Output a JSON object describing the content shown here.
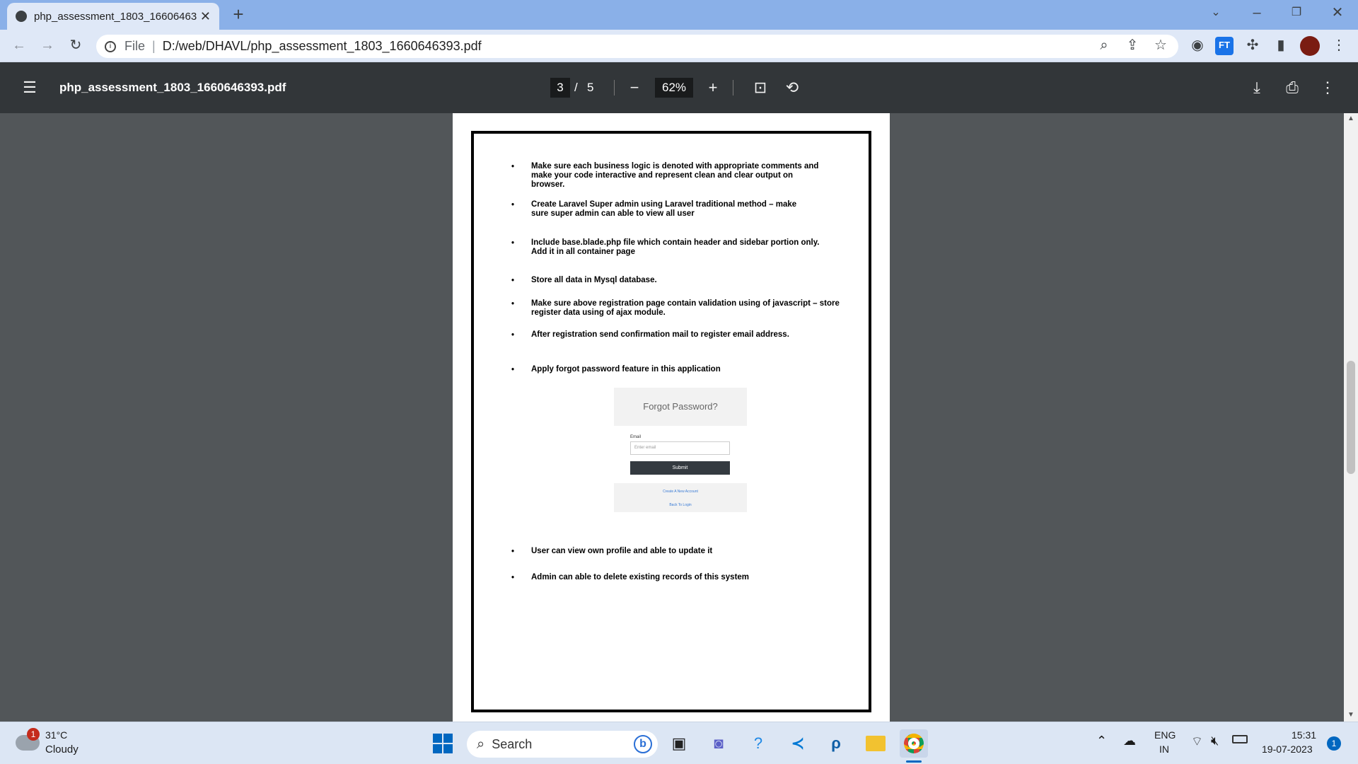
{
  "browser": {
    "tab_title": "php_assessment_1803_16606463",
    "address_prefix": "File",
    "address_url": "D:/web/DHAVL/php_assessment_1803_1660646393.pdf"
  },
  "pdf_viewer": {
    "file_title": "php_assessment_1803_1660646393.pdf",
    "current_page": "3",
    "page_separator": "/",
    "total_pages": "5",
    "zoom": "62%"
  },
  "document": {
    "bullets": [
      {
        "lines": [
          "Make sure each business logic is denoted with appropriate comments and",
          "make your code interactive and represent clean and clear output on",
          "browser."
        ]
      },
      {
        "lines": [
          "Create Laravel Super admin using Laravel traditional method – make",
          "sure super admin can able to view all user"
        ]
      },
      {
        "lines": [
          "Include base.blade.php file which contain header and sidebar portion only.",
          "Add it in all container page"
        ]
      },
      {
        "lines": [
          "Store all data in Mysql database."
        ]
      },
      {
        "lines": [
          "Make sure above registration page contain validation using of javascript – store",
          "register data using of ajax module."
        ]
      },
      {
        "lines": [
          "After registration send confirmation mail to register email address."
        ]
      },
      {
        "lines": [
          "Apply forgot password feature in this application"
        ]
      },
      {
        "lines": [
          "User can view own profile and able to update it"
        ]
      },
      {
        "lines": [
          "Admin can able to delete existing records of this system"
        ]
      }
    ],
    "forgot_password": {
      "title": "Forgot Password?",
      "email_label": "Email",
      "email_placeholder": "Enter email",
      "submit_label": "Submit",
      "create_account_link": "Create A New Account",
      "back_to_login_link": "Back To Login"
    }
  },
  "taskbar": {
    "weather_temp": "31°C",
    "weather_desc": "Cloudy",
    "weather_badge": "1",
    "search_label": "Search",
    "lang_top": "ENG",
    "lang_bottom": "IN",
    "time": "15:31",
    "date": "19-07-2023",
    "notification_count": "1"
  }
}
